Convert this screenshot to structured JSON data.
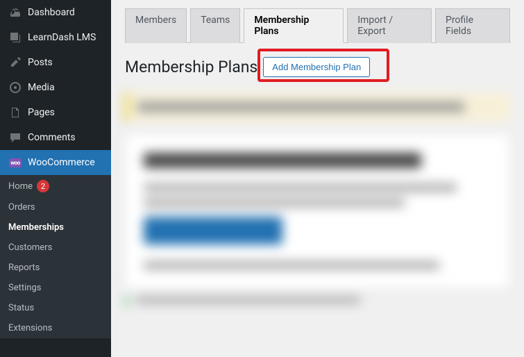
{
  "sidebar": {
    "items": [
      {
        "label": "Dashboard"
      },
      {
        "label": "LearnDash LMS"
      },
      {
        "label": "Posts"
      },
      {
        "label": "Media"
      },
      {
        "label": "Pages"
      },
      {
        "label": "Comments"
      },
      {
        "label": "WooCommerce"
      }
    ],
    "submenu": [
      {
        "label": "Home",
        "badge": "2"
      },
      {
        "label": "Orders"
      },
      {
        "label": "Memberships"
      },
      {
        "label": "Customers"
      },
      {
        "label": "Reports"
      },
      {
        "label": "Settings"
      },
      {
        "label": "Status"
      },
      {
        "label": "Extensions"
      }
    ]
  },
  "tabs": [
    {
      "label": "Members"
    },
    {
      "label": "Teams"
    },
    {
      "label": "Membership Plans"
    },
    {
      "label": "Import / Export"
    },
    {
      "label": "Profile Fields"
    }
  ],
  "page": {
    "title": "Membership Plans",
    "add_button": "Add Membership Plan"
  }
}
